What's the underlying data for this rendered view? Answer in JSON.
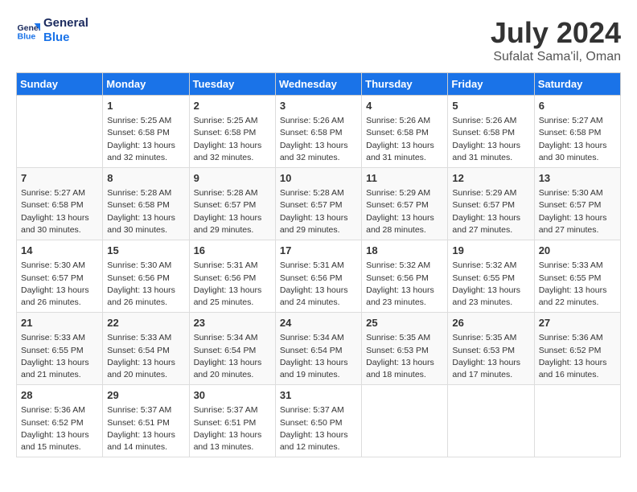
{
  "logo": {
    "line1": "General",
    "line2": "Blue"
  },
  "title": "July 2024",
  "location": "Sufalat Sama'il, Oman",
  "days_header": [
    "Sunday",
    "Monday",
    "Tuesday",
    "Wednesday",
    "Thursday",
    "Friday",
    "Saturday"
  ],
  "weeks": [
    [
      {
        "day": "",
        "content": ""
      },
      {
        "day": "1",
        "content": "Sunrise: 5:25 AM\nSunset: 6:58 PM\nDaylight: 13 hours\nand 32 minutes."
      },
      {
        "day": "2",
        "content": "Sunrise: 5:25 AM\nSunset: 6:58 PM\nDaylight: 13 hours\nand 32 minutes."
      },
      {
        "day": "3",
        "content": "Sunrise: 5:26 AM\nSunset: 6:58 PM\nDaylight: 13 hours\nand 32 minutes."
      },
      {
        "day": "4",
        "content": "Sunrise: 5:26 AM\nSunset: 6:58 PM\nDaylight: 13 hours\nand 31 minutes."
      },
      {
        "day": "5",
        "content": "Sunrise: 5:26 AM\nSunset: 6:58 PM\nDaylight: 13 hours\nand 31 minutes."
      },
      {
        "day": "6",
        "content": "Sunrise: 5:27 AM\nSunset: 6:58 PM\nDaylight: 13 hours\nand 30 minutes."
      }
    ],
    [
      {
        "day": "7",
        "content": "Sunrise: 5:27 AM\nSunset: 6:58 PM\nDaylight: 13 hours\nand 30 minutes."
      },
      {
        "day": "8",
        "content": "Sunrise: 5:28 AM\nSunset: 6:58 PM\nDaylight: 13 hours\nand 30 minutes."
      },
      {
        "day": "9",
        "content": "Sunrise: 5:28 AM\nSunset: 6:57 PM\nDaylight: 13 hours\nand 29 minutes."
      },
      {
        "day": "10",
        "content": "Sunrise: 5:28 AM\nSunset: 6:57 PM\nDaylight: 13 hours\nand 29 minutes."
      },
      {
        "day": "11",
        "content": "Sunrise: 5:29 AM\nSunset: 6:57 PM\nDaylight: 13 hours\nand 28 minutes."
      },
      {
        "day": "12",
        "content": "Sunrise: 5:29 AM\nSunset: 6:57 PM\nDaylight: 13 hours\nand 27 minutes."
      },
      {
        "day": "13",
        "content": "Sunrise: 5:30 AM\nSunset: 6:57 PM\nDaylight: 13 hours\nand 27 minutes."
      }
    ],
    [
      {
        "day": "14",
        "content": "Sunrise: 5:30 AM\nSunset: 6:57 PM\nDaylight: 13 hours\nand 26 minutes."
      },
      {
        "day": "15",
        "content": "Sunrise: 5:30 AM\nSunset: 6:56 PM\nDaylight: 13 hours\nand 26 minutes."
      },
      {
        "day": "16",
        "content": "Sunrise: 5:31 AM\nSunset: 6:56 PM\nDaylight: 13 hours\nand 25 minutes."
      },
      {
        "day": "17",
        "content": "Sunrise: 5:31 AM\nSunset: 6:56 PM\nDaylight: 13 hours\nand 24 minutes."
      },
      {
        "day": "18",
        "content": "Sunrise: 5:32 AM\nSunset: 6:56 PM\nDaylight: 13 hours\nand 23 minutes."
      },
      {
        "day": "19",
        "content": "Sunrise: 5:32 AM\nSunset: 6:55 PM\nDaylight: 13 hours\nand 23 minutes."
      },
      {
        "day": "20",
        "content": "Sunrise: 5:33 AM\nSunset: 6:55 PM\nDaylight: 13 hours\nand 22 minutes."
      }
    ],
    [
      {
        "day": "21",
        "content": "Sunrise: 5:33 AM\nSunset: 6:55 PM\nDaylight: 13 hours\nand 21 minutes."
      },
      {
        "day": "22",
        "content": "Sunrise: 5:33 AM\nSunset: 6:54 PM\nDaylight: 13 hours\nand 20 minutes."
      },
      {
        "day": "23",
        "content": "Sunrise: 5:34 AM\nSunset: 6:54 PM\nDaylight: 13 hours\nand 20 minutes."
      },
      {
        "day": "24",
        "content": "Sunrise: 5:34 AM\nSunset: 6:54 PM\nDaylight: 13 hours\nand 19 minutes."
      },
      {
        "day": "25",
        "content": "Sunrise: 5:35 AM\nSunset: 6:53 PM\nDaylight: 13 hours\nand 18 minutes."
      },
      {
        "day": "26",
        "content": "Sunrise: 5:35 AM\nSunset: 6:53 PM\nDaylight: 13 hours\nand 17 minutes."
      },
      {
        "day": "27",
        "content": "Sunrise: 5:36 AM\nSunset: 6:52 PM\nDaylight: 13 hours\nand 16 minutes."
      }
    ],
    [
      {
        "day": "28",
        "content": "Sunrise: 5:36 AM\nSunset: 6:52 PM\nDaylight: 13 hours\nand 15 minutes."
      },
      {
        "day": "29",
        "content": "Sunrise: 5:37 AM\nSunset: 6:51 PM\nDaylight: 13 hours\nand 14 minutes."
      },
      {
        "day": "30",
        "content": "Sunrise: 5:37 AM\nSunset: 6:51 PM\nDaylight: 13 hours\nand 13 minutes."
      },
      {
        "day": "31",
        "content": "Sunrise: 5:37 AM\nSunset: 6:50 PM\nDaylight: 13 hours\nand 12 minutes."
      },
      {
        "day": "",
        "content": ""
      },
      {
        "day": "",
        "content": ""
      },
      {
        "day": "",
        "content": ""
      }
    ]
  ]
}
